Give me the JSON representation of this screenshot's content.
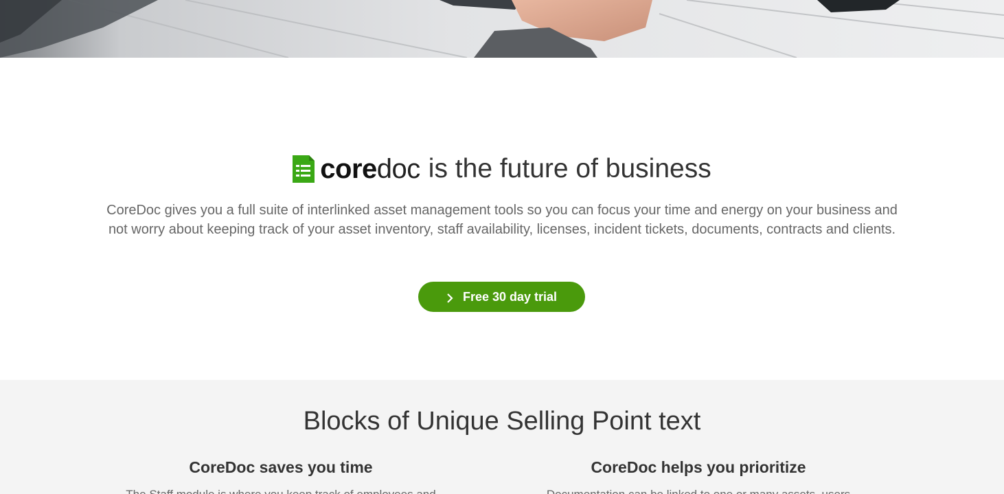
{
  "hero": {
    "image": "office-desk-photo"
  },
  "intro": {
    "logo_icon": "document-list-icon",
    "brand_strong": "core",
    "brand_light": "doc",
    "headline_rest": "is the future of business",
    "description": "CoreDoc gives you a full suite of interlinked asset management tools so you can focus your time and energy on your business and not worry about keeping track of your asset inventory, staff availability, licenses, incident tickets, documents, contracts and clients.",
    "cta_icon": "chevron-right-icon",
    "cta_label": "Free 30 day trial"
  },
  "usp": {
    "title": "Blocks of Unique Selling Point text",
    "blocks": [
      {
        "heading": "CoreDoc saves you time",
        "body": "The Staff module is where you keep track of employees and"
      },
      {
        "heading": "CoreDoc helps you prioritize",
        "body": "Documentation can be linked to one or many assets, users"
      }
    ]
  },
  "colors": {
    "brand_green": "#4a9a0c",
    "logo_green": "#3aa815",
    "usp_background": "#f4f4f4"
  }
}
